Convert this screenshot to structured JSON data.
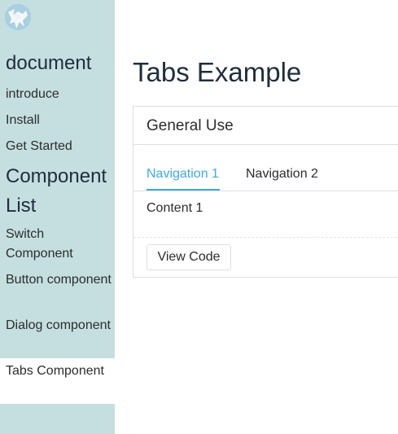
{
  "sidebar": {
    "logo_icon": "vue-logo",
    "doc_heading": "document",
    "doc_links": [
      "introduce",
      "Install",
      "Get Started"
    ],
    "component_heading": "Component List",
    "component_links": [
      "Switch Component",
      "Button component",
      "Dialog component",
      "Tabs Component"
    ],
    "active_link": "Tabs Component",
    "background_color": "#c5dfe0"
  },
  "main": {
    "title": "Tabs Example",
    "card": {
      "title": "General Use",
      "tabs": [
        {
          "label": "Navigation 1",
          "active": true
        },
        {
          "label": "Navigation 2",
          "active": false
        }
      ],
      "content": "Content 1",
      "view_code_label": "View Code"
    },
    "accent_color": "#3fa8e6"
  }
}
